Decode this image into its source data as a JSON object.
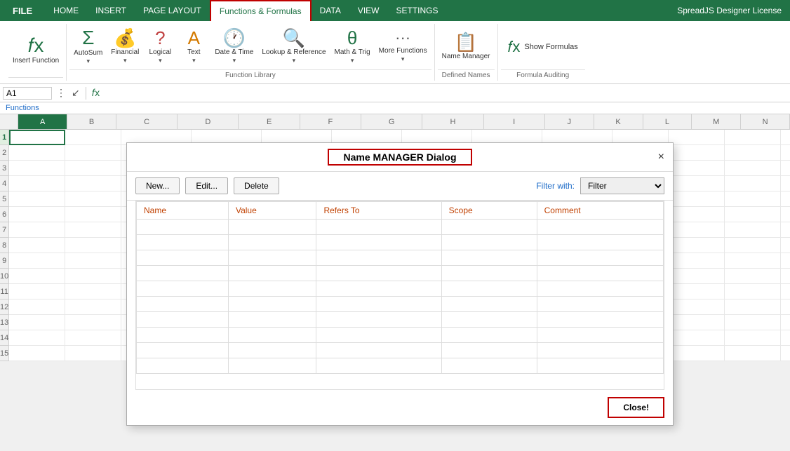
{
  "menubar": {
    "file_label": "FILE",
    "items": [
      "HOME",
      "INSERT",
      "PAGE LAYOUT",
      "Functions & Formulas",
      "DATA",
      "VIEW",
      "SETTINGS"
    ],
    "active_tab": "Functions & Formulas",
    "spreadjs_label": "SpreadJS Designer License"
  },
  "ribbon": {
    "insert_function": {
      "icon": "𝑓x",
      "label": "Insert\nFunction"
    },
    "autosum": {
      "icon": "Σ",
      "label": "AutoSum"
    },
    "financial": {
      "icon": "💰",
      "label": "Financial"
    },
    "logical": {
      "icon": "?",
      "label": "Logical"
    },
    "text": {
      "icon": "A",
      "label": "Text"
    },
    "date_time": {
      "icon": "🕐",
      "label": "Date &\nTime"
    },
    "lookup_reference": {
      "icon": "🔍",
      "label": "Lookup &\nReference"
    },
    "math_trig": {
      "icon": "θ",
      "label": "Math &\nTrig"
    },
    "more_functions": {
      "icon": "···",
      "label": "More\nFunctions"
    },
    "name_manager": {
      "icon": "📋",
      "label": "Name\nManager"
    },
    "show_formulas": {
      "icon": "𝑓x",
      "label": "Show Formulas"
    },
    "sections": {
      "function_library": "Function Library",
      "defined_names": "Defined Names",
      "formula_auditing": "Formula Auditing"
    }
  },
  "formula_bar": {
    "name_box": "A1",
    "fx_label": "fx",
    "formula_value": ""
  },
  "functions_label": "Functions",
  "spreadsheet": {
    "columns": [
      "A",
      "B",
      "C",
      "D",
      "E",
      "F",
      "G",
      "H",
      "I",
      "J",
      "K",
      "L",
      "M",
      "N"
    ],
    "active_cell": "A1",
    "rows": [
      1,
      2,
      3,
      4,
      5,
      6,
      7,
      8,
      9,
      10,
      11,
      12,
      13,
      14,
      15
    ]
  },
  "dialog": {
    "title": "Name MANAGER Dialog",
    "close_icon": "×",
    "buttons": {
      "new": "New...",
      "edit": "Edit...",
      "delete": "Delete"
    },
    "filter_label": "Filter with:",
    "filter_placeholder": "Filter",
    "table": {
      "headers": [
        "Name",
        "Value",
        "Refers To",
        "Scope",
        "Comment"
      ],
      "rows": []
    },
    "close_button": "Close!"
  }
}
